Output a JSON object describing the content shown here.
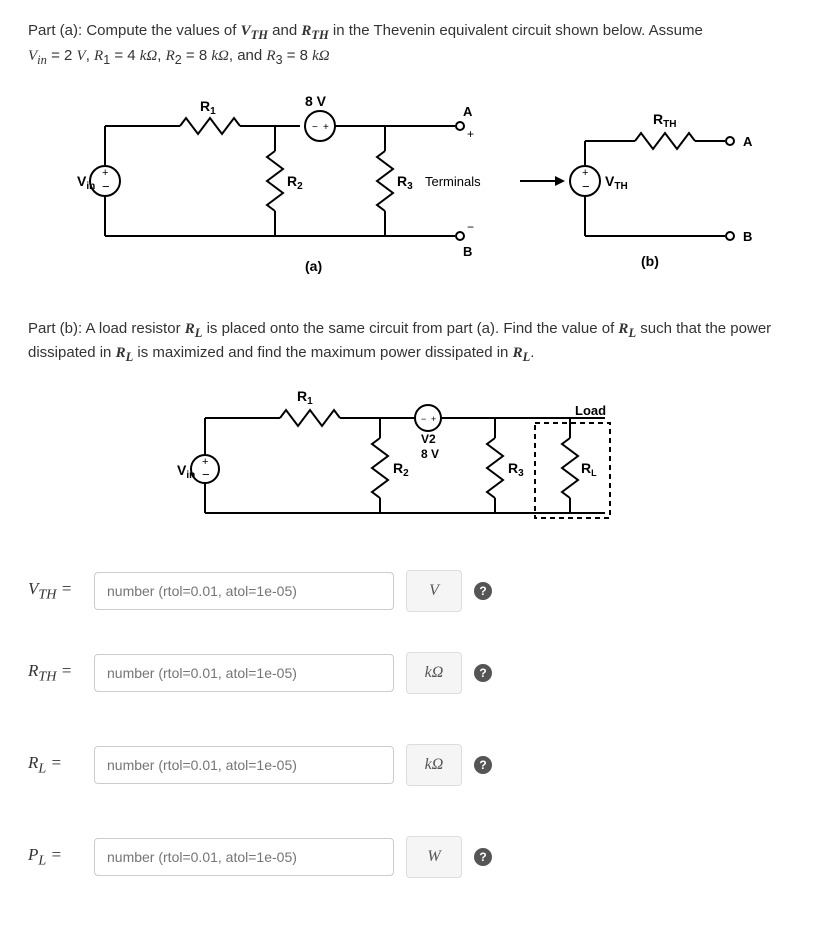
{
  "partA": {
    "intro": "Part (a): Compute the values of ",
    "vth_sym": "V",
    "vth_sub": "TH",
    "and": " and ",
    "rth_sym": "R",
    "rth_sub": "TH",
    "tail": " in the Thevenin equivalent circuit shown below. Assume",
    "given": "Vin = 2 V, R₁ = 4 kΩ, R₂ = 8 kΩ, and R₃ = 8 kΩ"
  },
  "diagramA": {
    "R1": "R₁",
    "R2": "R₂",
    "R3": "R₃",
    "Vin": "Vin",
    "V8": "8 V",
    "A": "A",
    "B": "B",
    "Terminals": "Terminals",
    "a_label": "(a)",
    "RTH": "R",
    "RTH_sub": "TH",
    "VTH": "V",
    "VTH_sub": "TH",
    "b_label": "(b)"
  },
  "partB": {
    "prefix": "Part (b): A load resistor ",
    "RL": "R",
    "RL_sub": "L",
    "mid1": " is placed onto the same circuit from part (a). Find the value of ",
    "mid2": " such that the power dissipated in ",
    "mid3": " is maximized and find the maximum power dissipated in ",
    "end": "."
  },
  "diagramB": {
    "R1": "R₁",
    "R2": "R₂",
    "R3": "R₃",
    "Vin": "Vin",
    "V2": "V2",
    "V8": "8 V",
    "RL": "R",
    "RL_sub": "L",
    "Load": "Load"
  },
  "answers": {
    "placeholder": "number (rtol=0.01, atol=1e-05)",
    "vth_label": "V",
    "vth_sub": "TH",
    "vth_unit": "V",
    "rth_label": "R",
    "rth_sub": "TH",
    "rth_unit": "kΩ",
    "rl_label": "R",
    "rl_sub": "L",
    "rl_unit": "kΩ",
    "pl_label": "P",
    "pl_sub": "L",
    "pl_unit": "W",
    "help": "?"
  }
}
